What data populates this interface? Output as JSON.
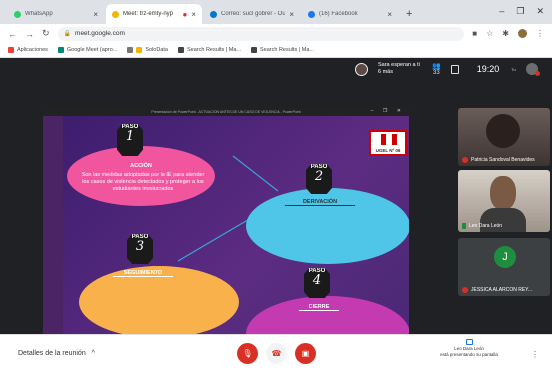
{
  "browser": {
    "tabs": [
      {
        "title": "WhatsApp",
        "color": "#25d366",
        "active": false
      },
      {
        "title": "Meet: trz-emty-nyp",
        "color": "#f4b400",
        "active": true
      },
      {
        "title": "Correo: sucl gobrer - Outlook",
        "color": "#0078d4",
        "active": false
      },
      {
        "title": "(16) Facebook",
        "color": "#1877f2",
        "active": false
      }
    ],
    "url": "meet.google.com",
    "bookmarks": [
      {
        "label": "Aplicaciones",
        "color": "#e94235"
      },
      {
        "label": "Google Meet (apro...",
        "color": "#00897b"
      },
      {
        "label": "SoloData",
        "color": "#f4b400"
      },
      {
        "label": "Search Results | Ma...",
        "color": "#444444"
      },
      {
        "label": "Search Results | Ma...",
        "color": "#444444"
      }
    ]
  },
  "meet": {
    "speaker_text": "Sara esperan a ti 6 más",
    "people_count": "33",
    "time": "19:20",
    "time_sub": "Tu"
  },
  "shared_window": {
    "title": "Presentación de PowerPoint - ACTUACION ANTES DE UN CASO DE VIOLENCIA - PowerPoint",
    "logo_text": "UGEL Nº 06",
    "steps": [
      {
        "badge_label": "PASO",
        "badge_number": "1",
        "name": "ACCIÓN",
        "description": "Son las medidas adoptadas por la IE para atender los casos de violencia detectados y proteger a los estudiantes involucrados",
        "color": "#f0559e"
      },
      {
        "badge_label": "PASO",
        "badge_number": "2",
        "name": "DERIVACIÓN",
        "color": "#4fc6e8"
      },
      {
        "badge_label": "PASO",
        "badge_number": "3",
        "name": "SEGUIMIENTO",
        "color": "#f9b24b"
      },
      {
        "badge_label": "PASO",
        "badge_number": "4",
        "name": "CIERRE",
        "color": "#c43ab0"
      }
    ]
  },
  "participants": [
    {
      "name": "Patricia Sandoval Benavides",
      "muted": true
    },
    {
      "name": "Leo Dara León",
      "muted": false
    },
    {
      "name": "JESSICA ALARCON REY...",
      "initial": "J",
      "muted": true
    }
  ],
  "bottombar": {
    "details_label": "Detalles de la reunión",
    "presenter_name": "Leo Dara León",
    "presenter_status": "está presentando su pantalla"
  }
}
